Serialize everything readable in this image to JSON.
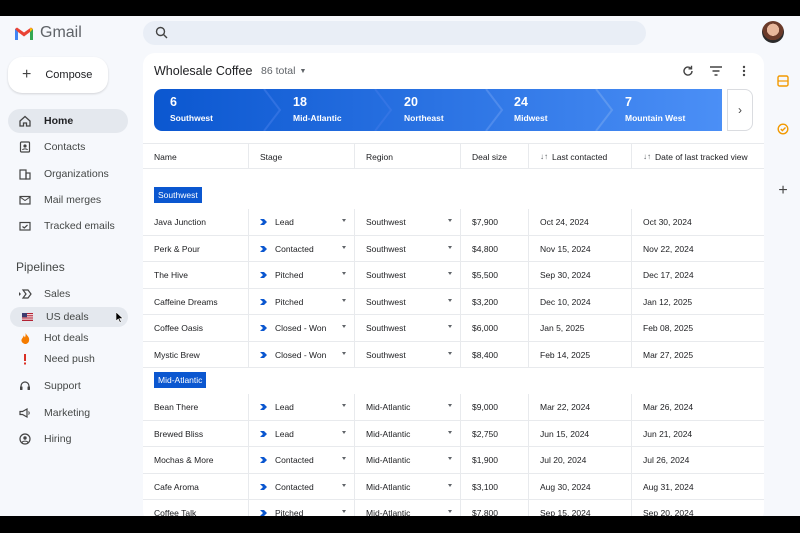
{
  "app": {
    "name": "Gmail"
  },
  "compose_label": "Compose",
  "nav": [
    {
      "label": "Home",
      "icon": "home-icon"
    },
    {
      "label": "Contacts",
      "icon": "contacts-icon"
    },
    {
      "label": "Organizations",
      "icon": "organizations-icon"
    },
    {
      "label": "Mail merges",
      "icon": "mail-merge-icon"
    },
    {
      "label": "Tracked emails",
      "icon": "tracked-email-icon"
    }
  ],
  "pipelines_label": "Pipelines",
  "pipelines": [
    {
      "label": "Sales",
      "icon": "pipeline-icon"
    },
    {
      "label": "US deals",
      "icon": "us-flag-icon"
    },
    {
      "label": "Hot deals",
      "icon": "fire-icon"
    },
    {
      "label": "Need push",
      "icon": "exclamation-icon"
    },
    {
      "label": "Support",
      "icon": "support-icon"
    },
    {
      "label": "Marketing",
      "icon": "marketing-icon"
    },
    {
      "label": "Hiring",
      "icon": "hiring-icon"
    }
  ],
  "view": {
    "title": "Wholesale Coffee",
    "count": "86 total",
    "stages": [
      {
        "count": "6",
        "label": "Southwest"
      },
      {
        "count": "18",
        "label": "Mid-Atlantic"
      },
      {
        "count": "20",
        "label": "Northeast"
      },
      {
        "count": "24",
        "label": "Midwest"
      },
      {
        "count": "7",
        "label": "Mountain West"
      }
    ],
    "columns": [
      "Name",
      "Stage",
      "Region",
      "Deal size",
      "Last contacted",
      "Date of last tracked view"
    ],
    "groups": [
      {
        "label": "Southwest",
        "rows": [
          {
            "name": "Java Junction",
            "stage": "Lead",
            "region": "Southwest",
            "deal": "$7,900",
            "last_contacted": "Oct 24, 2024",
            "last_view": "Oct 30, 2024"
          },
          {
            "name": "Perk & Pour",
            "stage": "Contacted",
            "region": "Southwest",
            "deal": "$4,800",
            "last_contacted": "Nov 15, 2024",
            "last_view": "Nov 22, 2024"
          },
          {
            "name": "The Hive",
            "stage": "Pitched",
            "region": "Southwest",
            "deal": "$5,500",
            "last_contacted": "Sep 30, 2024",
            "last_view": "Dec 17, 2024"
          },
          {
            "name": "Caffeine Dreams",
            "stage": "Pitched",
            "region": "Southwest",
            "deal": "$3,200",
            "last_contacted": "Dec 10, 2024",
            "last_view": "Jan 12, 2025"
          },
          {
            "name": "Coffee Oasis",
            "stage": "Closed - Won",
            "region": "Southwest",
            "deal": "$6,000",
            "last_contacted": "Jan 5, 2025",
            "last_view": "Feb 08, 2025"
          },
          {
            "name": "Mystic Brew",
            "stage": "Closed - Won",
            "region": "Southwest",
            "deal": "$8,400",
            "last_contacted": "Feb 14, 2025",
            "last_view": "Mar 27, 2025"
          }
        ]
      },
      {
        "label": "Mid-Atlantic",
        "rows": [
          {
            "name": "Bean There",
            "stage": "Lead",
            "region": "Mid-Atlantic",
            "deal": "$9,000",
            "last_contacted": "Mar 22, 2024",
            "last_view": "Mar 26, 2024"
          },
          {
            "name": "Brewed Bliss",
            "stage": "Lead",
            "region": "Mid-Atlantic",
            "deal": "$2,750",
            "last_contacted": "Jun 15, 2024",
            "last_view": "Jun 21, 2024"
          },
          {
            "name": "Mochas & More",
            "stage": "Contacted",
            "region": "Mid-Atlantic",
            "deal": "$1,900",
            "last_contacted": "Jul 20, 2024",
            "last_view": "Jul 26, 2024"
          },
          {
            "name": "Cafe Aroma",
            "stage": "Contacted",
            "region": "Mid-Atlantic",
            "deal": "$3,100",
            "last_contacted": "Aug 30, 2024",
            "last_view": "Aug 31, 2024"
          },
          {
            "name": "Coffee Talk",
            "stage": "Pitched",
            "region": "Mid-Atlantic",
            "deal": "$7,800",
            "last_contacted": "Sep 15, 2024",
            "last_view": "Sep 20, 2024"
          }
        ]
      }
    ]
  },
  "colors": {
    "accent": "#0b57d0",
    "stage_gradient_end": "#4b8ff6",
    "background": "#f6f8fc"
  }
}
